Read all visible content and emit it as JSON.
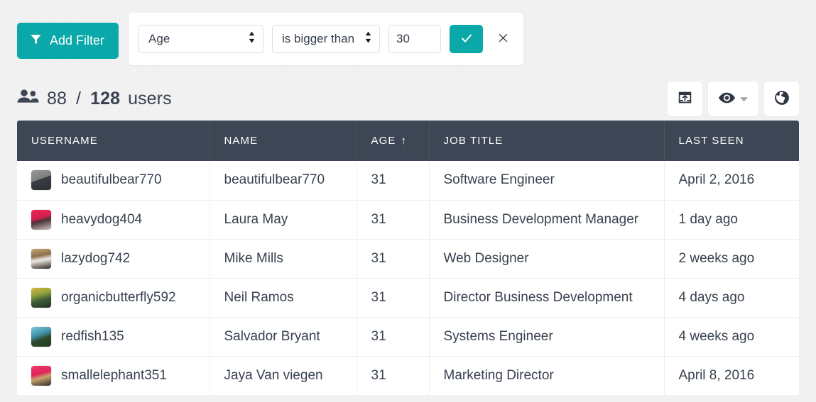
{
  "filter_bar": {
    "add_filter_label": "Add Filter",
    "add_filter_icon": "funnel-icon",
    "active_filter": {
      "field_value": "Age",
      "field_options": [
        "Age"
      ],
      "operator_value": "is bigger than",
      "operator_options": [
        "is bigger than"
      ],
      "value": "30",
      "value_placeholder": "",
      "apply_icon": "check-icon",
      "remove_icon": "close-icon"
    }
  },
  "summary": {
    "people_icon": "people-icon",
    "filtered_count": "88",
    "separator": "/",
    "total_count": "128",
    "unit_label": "users"
  },
  "toolbar": {
    "buttons": [
      {
        "name": "export-button",
        "icon": "export-box-icon",
        "has_caret": false
      },
      {
        "name": "visibility-button",
        "icon": "eye-icon",
        "has_caret": true
      },
      {
        "name": "locale-button",
        "icon": "globe-icon",
        "has_caret": false
      }
    ]
  },
  "table": {
    "columns": [
      {
        "key": "username",
        "label": "USERNAME",
        "sorted": false,
        "sort_arrow": ""
      },
      {
        "key": "name",
        "label": "NAME",
        "sorted": false,
        "sort_arrow": ""
      },
      {
        "key": "age",
        "label": "AGE",
        "sorted": true,
        "sort_arrow": "↑"
      },
      {
        "key": "job_title",
        "label": "JOB TITLE",
        "sorted": false,
        "sort_arrow": ""
      },
      {
        "key": "last_seen",
        "label": "LAST SEEN",
        "sorted": false,
        "sort_arrow": ""
      }
    ],
    "rows": [
      {
        "username": "beautifulbear770",
        "name": "beautifulbear770",
        "age": "31",
        "job_title": "Software Engineer",
        "last_seen": "April 2, 2016",
        "avatar": "avatar-0"
      },
      {
        "username": "heavydog404",
        "name": "Laura May",
        "age": "31",
        "job_title": "Business Development Manager",
        "last_seen": "1 day ago",
        "avatar": "avatar-1"
      },
      {
        "username": "lazydog742",
        "name": "Mike Mills",
        "age": "31",
        "job_title": "Web Designer",
        "last_seen": "2 weeks ago",
        "avatar": "avatar-2"
      },
      {
        "username": "organicbutterfly592",
        "name": "Neil Ramos",
        "age": "31",
        "job_title": "Director Business Development",
        "last_seen": "4 days ago",
        "avatar": "avatar-3"
      },
      {
        "username": "redfish135",
        "name": "Salvador Bryant",
        "age": "31",
        "job_title": "Systems Engineer",
        "last_seen": "4 weeks ago",
        "avatar": "avatar-4"
      },
      {
        "username": "smallelephant351",
        "name": "Jaya Van viegen",
        "age": "31",
        "job_title": "Marketing Director",
        "last_seen": "April 8, 2016",
        "avatar": "avatar-5"
      }
    ]
  },
  "colors": {
    "accent_teal": "#0aa8a8",
    "header_dark": "#3d4654",
    "page_background": "#f2f2f2",
    "text_primary": "#38414f",
    "surface_white": "#ffffff"
  }
}
